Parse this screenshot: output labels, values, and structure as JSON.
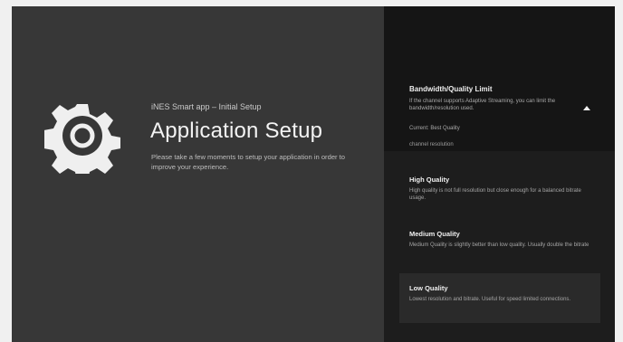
{
  "setup": {
    "subtitle": "iNES Smart app – Initial Setup",
    "title": "Application Setup",
    "description": "Please take a few moments to setup your application in order to improve your experience."
  },
  "preference": {
    "title": "Bandwidth/Quality Limit",
    "description": "If the channel supports Adaptive Streaming, you can limit the bandwidth/resolution used.",
    "current": "Current: Best Quality",
    "section_label": "channel resolution"
  },
  "options": [
    {
      "title": "High Quality",
      "description": "High quality is not full resolution but close enough for a balanced bitrate usage."
    },
    {
      "title": "Medium Quality",
      "description": "Medium Quality is slightly better than low quality. Usually double the bitrate"
    },
    {
      "title": "Low Quality",
      "description": "Lowest resolution and bitrate. Useful for speed limited connections."
    }
  ],
  "selected_option": "Low Quality",
  "colors": {
    "left_panel": "#373737",
    "right_panel": "#1d1d1d",
    "selected_option": "#2a2a2a"
  },
  "icons": {
    "setup": "gear-icon",
    "collapse": "arrow-up-icon"
  }
}
